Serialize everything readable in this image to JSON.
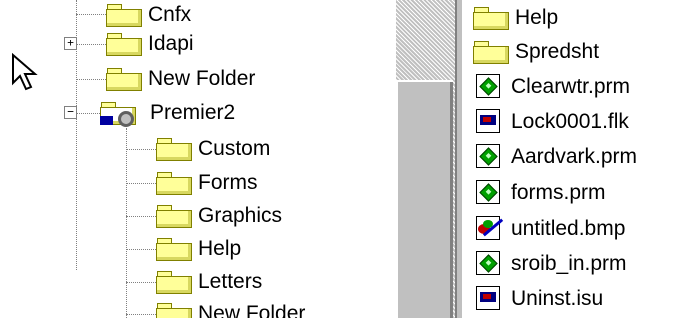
{
  "tree": {
    "items": [
      {
        "label": "Cnfx"
      },
      {
        "label": "Idapi",
        "expander": "+"
      },
      {
        "label": "New Folder"
      },
      {
        "label": "Premier2",
        "expander": "−"
      },
      {
        "label": "Custom"
      },
      {
        "label": "Forms"
      },
      {
        "label": "Graphics"
      },
      {
        "label": "Help"
      },
      {
        "label": "Letters"
      },
      {
        "label": "New Folder"
      }
    ]
  },
  "file_list": {
    "items": [
      {
        "label": "Help",
        "icon": "folder-icon"
      },
      {
        "label": "Spredsht",
        "icon": "folder-icon"
      },
      {
        "label": "Clearwtr.prm",
        "icon": "prm-file-icon"
      },
      {
        "label": "Lock0001.flk",
        "icon": "flk-file-icon"
      },
      {
        "label": "Aardvark.prm",
        "icon": "prm-file-icon"
      },
      {
        "label": "forms.prm",
        "icon": "prm-file-icon"
      },
      {
        "label": "untitled.bmp",
        "icon": "bitmap-file-icon"
      },
      {
        "label": "sroib_in.prm",
        "icon": "prm-file-icon"
      },
      {
        "label": "Uninst.isu",
        "icon": "isu-file-icon"
      }
    ]
  },
  "colors": {
    "folder_fill": "#ffff99",
    "folder_edge": "#808000",
    "chrome": "#c0c0c0",
    "prm_green": "#00a000"
  }
}
